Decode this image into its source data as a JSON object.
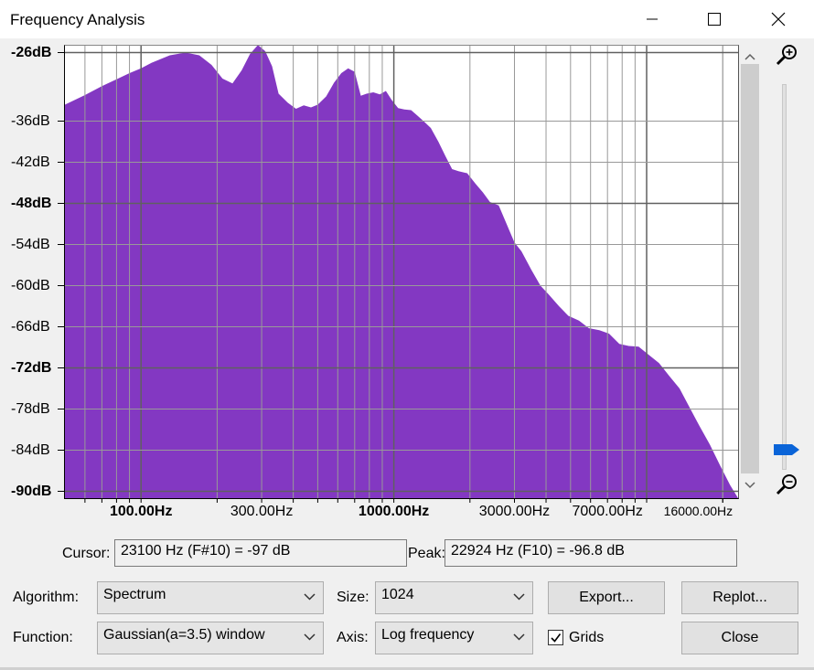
{
  "window": {
    "title": "Frequency Analysis",
    "minimize_label": "—",
    "maximize_label": "☐",
    "close_label": "✕"
  },
  "colors": {
    "spectrum_fill": "#8338c2",
    "grid_line": "#7a7a7a"
  },
  "chart_data": {
    "type": "area",
    "title": "",
    "xscale": "log",
    "xlim": [
      50,
      23000
    ],
    "ylim": [
      -91,
      -25
    ],
    "yticks": [
      {
        "value": -26,
        "label": "-26dB",
        "bold": true
      },
      {
        "value": -36,
        "label": "-36dB",
        "bold": false
      },
      {
        "value": -42,
        "label": "-42dB",
        "bold": false
      },
      {
        "value": -48,
        "label": "-48dB",
        "bold": true
      },
      {
        "value": -54,
        "label": "-54dB",
        "bold": false
      },
      {
        "value": -60,
        "label": "-60dB",
        "bold": false
      },
      {
        "value": -66,
        "label": "-66dB",
        "bold": false
      },
      {
        "value": -72,
        "label": "-72dB",
        "bold": true
      },
      {
        "value": -78,
        "label": "-78dB",
        "bold": false
      },
      {
        "value": -84,
        "label": "-84dB",
        "bold": false
      },
      {
        "value": -90,
        "label": "-90dB",
        "bold": true
      }
    ],
    "xticks": [
      {
        "value": 100,
        "label": "100.00Hz",
        "bold": true
      },
      {
        "value": 300,
        "label": "300.00Hz",
        "bold": false
      },
      {
        "value": 1000,
        "label": "1000.00Hz",
        "bold": true
      },
      {
        "value": 3000,
        "label": "3000.00Hz",
        "bold": false
      },
      {
        "value": 7000,
        "label": "7000.00Hz",
        "bold": false
      },
      {
        "value": 16000,
        "label": "16000.00Hz",
        "bold": false
      }
    ],
    "grid": true,
    "x": [
      50,
      60,
      70,
      80,
      90,
      100,
      110,
      130,
      150,
      170,
      190,
      210,
      230,
      250,
      270,
      290,
      310,
      330,
      350,
      380,
      410,
      440,
      470,
      500,
      540,
      580,
      620,
      660,
      700,
      740,
      780,
      830,
      880,
      930,
      980,
      1040,
      1100,
      1170,
      1240,
      1320,
      1400,
      1500,
      1600,
      1700,
      1800,
      1950,
      2100,
      2250,
      2400,
      2600,
      2800,
      3000,
      3200,
      3500,
      3800,
      4100,
      4500,
      4900,
      5400,
      5900,
      6500,
      7100,
      7800,
      8500,
      9300,
      10200,
      11200,
      12300,
      13500,
      14800,
      16200,
      17800,
      19500,
      21400,
      23000
    ],
    "y": [
      -33.6,
      -32.2,
      -30.9,
      -29.9,
      -29.0,
      -28.3,
      -27.5,
      -26.4,
      -26.0,
      -26.4,
      -27.8,
      -29.8,
      -30.5,
      -28.6,
      -26.2,
      -24.9,
      -25.8,
      -28.0,
      -32.0,
      -33.3,
      -34.2,
      -33.7,
      -34.0,
      -33.6,
      -32.4,
      -30.4,
      -29.0,
      -28.3,
      -28.8,
      -32.3,
      -32.0,
      -31.8,
      -32.1,
      -31.6,
      -32.9,
      -34.1,
      -34.3,
      -34.4,
      -35.2,
      -36.1,
      -37.0,
      -39.0,
      -41.1,
      -43.0,
      -43.3,
      -43.6,
      -45.1,
      -46.4,
      -47.8,
      -48.3,
      -51.1,
      -53.7,
      -55.0,
      -57.7,
      -60.0,
      -61.3,
      -63.0,
      -64.4,
      -65.1,
      -66.2,
      -66.5,
      -67.0,
      -68.5,
      -68.8,
      -68.9,
      -70.1,
      -71.3,
      -73.2,
      -75.0,
      -77.8,
      -80.5,
      -83.2,
      -86.2,
      -89.1,
      -91.0
    ]
  },
  "cursor": {
    "label": "Cursor:",
    "value": "23100 Hz (F#10) = -97 dB"
  },
  "peak": {
    "label": "Peak:",
    "value": "22924 Hz (F10) = -96.8 dB"
  },
  "controls": {
    "algorithm_label": "Algorithm:",
    "algorithm_value": "Spectrum",
    "size_label": "Size:",
    "size_value": "1024",
    "export_label": "Export...",
    "replot_label": "Replot...",
    "function_label": "Function:",
    "function_value": "Gaussian(a=3.5) window",
    "axis_label": "Axis:",
    "axis_value": "Log frequency",
    "grids_label": "Grids",
    "grids_checked": true,
    "close_label": "Close"
  }
}
